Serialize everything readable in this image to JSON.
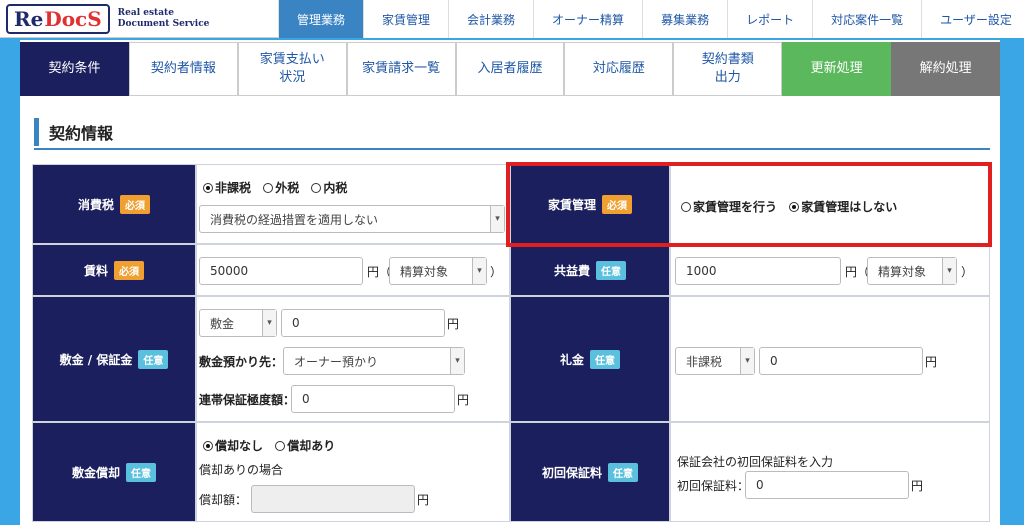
{
  "logo": {
    "badge_re": "Re",
    "badge_docs": "DocS",
    "sub_line1": "Real estate",
    "sub_line2": "Document Service"
  },
  "mainnav": [
    "管理業務",
    "家賃管理",
    "会計業務",
    "オーナー精算",
    "募集業務",
    "レポート",
    "対応案件一覧",
    "ユーザー設定"
  ],
  "subtabs": [
    "契約条件",
    "契約者情報",
    "家賃支払い\n状況",
    "家賃請求一覧",
    "入居者履歴",
    "対応履歴",
    "契約書類\n出力",
    "更新処理",
    "解約処理"
  ],
  "section_title": "契約情報",
  "badges": {
    "required": "必須",
    "optional": "任意"
  },
  "tax": {
    "label": "消費税",
    "radios": [
      "非課税",
      "外税",
      "内税"
    ],
    "select_value": "消費税の経過措置を適用しない"
  },
  "rent_mgmt": {
    "label": "家賃管理",
    "radios": [
      "家賃管理を行う",
      "家賃管理はしない"
    ]
  },
  "rent": {
    "label": "賃料",
    "value": "50000",
    "unit": "円（",
    "select": "精算対象",
    "close": "）"
  },
  "common_fee": {
    "label": "共益費",
    "value": "1000",
    "unit": "円（",
    "select": "精算対象",
    "close": "）"
  },
  "deposit": {
    "label": "敷金 / 保証金",
    "type_select": "敷金",
    "value": "0",
    "unit": "円",
    "holder_label": "敷金預かり先：",
    "holder_select": "オーナー預かり",
    "guarantee_label": "連帯保証極度額：",
    "guarantee_value": "0",
    "guarantee_unit": "円"
  },
  "key_money": {
    "label": "礼金",
    "tax_select": "非課税",
    "value": "0",
    "unit": "円"
  },
  "amortization": {
    "label": "敷金償却",
    "radios": [
      "償却なし",
      "償却あり"
    ],
    "note": "償却ありの場合",
    "amount_label": "償却額：",
    "amount_value": "",
    "unit": "円"
  },
  "initial_guarantee": {
    "label": "初回保証料",
    "note": "保証会社の初回保証料を入力",
    "amount_label": "初回保証料：",
    "value": "0",
    "unit": "円"
  }
}
